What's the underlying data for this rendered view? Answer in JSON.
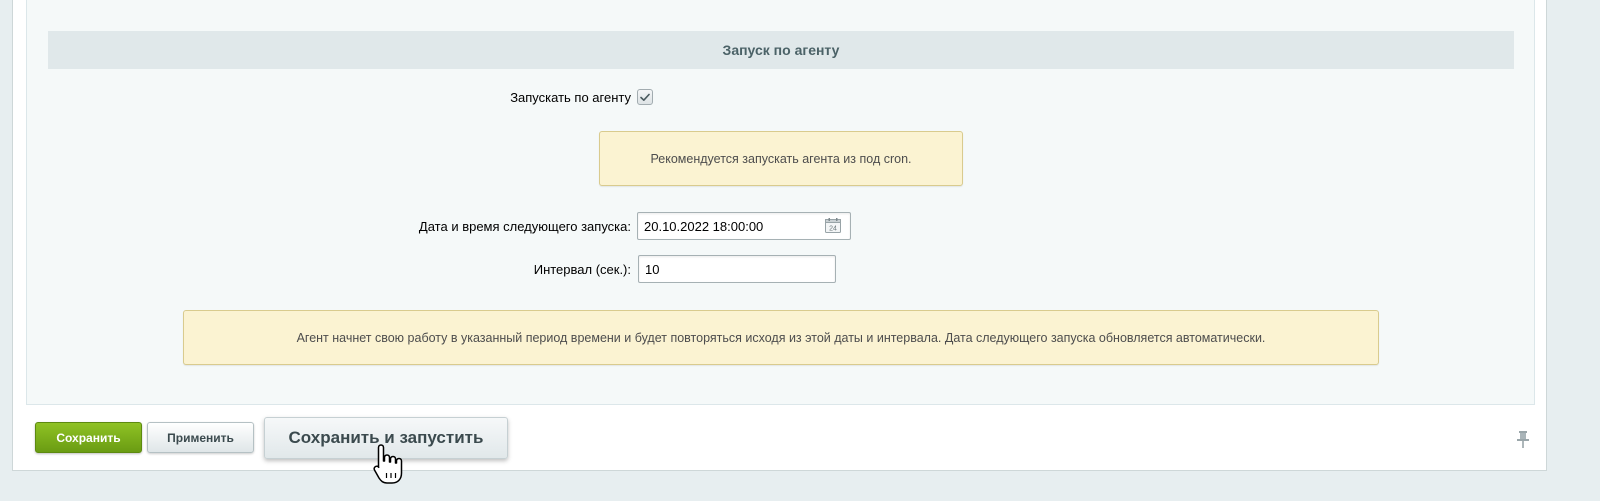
{
  "section": {
    "title": "Запуск по агенту"
  },
  "agent": {
    "run_by_agent_label": "Запускать по агенту",
    "run_by_agent_checked": true,
    "cron_note": "Рекомендуется запускать агента из под cron.",
    "next_run_label": "Дата и время следующего запуска:",
    "next_run_value": "20.10.2022 18:00:00",
    "interval_label": "Интервал (сек.):",
    "interval_value": "10",
    "info_note": "Агент начнет свою работу в указанный период времени и будет повторяться исходя из этой даты и интервала. Дата следующего запуска обновляется автоматически."
  },
  "footer": {
    "save_label": "Сохранить",
    "apply_label": "Применить",
    "save_and_run_label": "Сохранить и запустить"
  },
  "icons": {
    "checkbox": "checkmark-icon",
    "calendar": "calendar-icon",
    "pin": "pin-icon",
    "cursor": "hand-cursor-icon"
  },
  "colors": {
    "save_button": "#7aac1a",
    "section_header_bg": "#e0e8ea",
    "note_bg": "#fbf3d2"
  }
}
